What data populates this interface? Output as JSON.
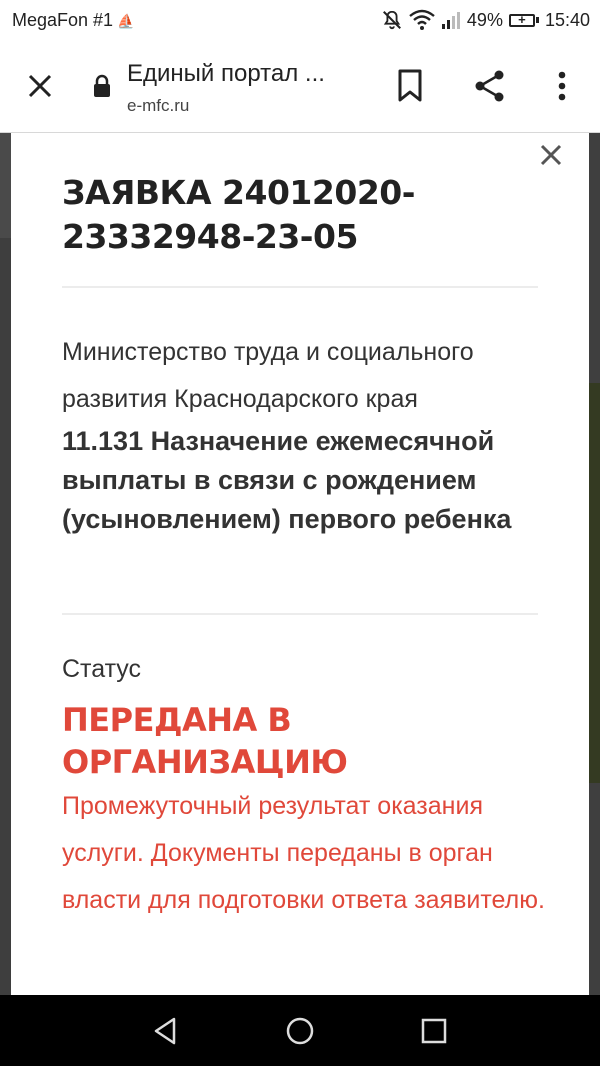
{
  "status_bar": {
    "carrier": "MegaFon #1",
    "battery_percent": "49%",
    "time": "15:40",
    "icons": [
      "boat-icon",
      "mute-icon",
      "wifi-icon",
      "signal-icon",
      "battery-charging-icon"
    ]
  },
  "browser": {
    "page_title": "Единый портал ...",
    "url": "e-mfc.ru",
    "icons": [
      "close-icon",
      "lock-icon",
      "bookmark-icon",
      "share-icon",
      "more-vert-icon"
    ]
  },
  "modal": {
    "title": "ЗАЯВКА 24012020-23332948-23-05",
    "ministry": "Министерство труда и социального развития Краснодарского края",
    "service": "11.131 Назначение ежемесячной выплаты в связи с рождением (усыновлением) первого ребенка",
    "status_label": "Статус",
    "status_value": "ПЕРЕДАНА В ОРГАНИЗАЦИЮ",
    "status_description": "Промежуточный результат оказания услуги. Документы переданы в орган власти для подготовки ответа заявителю.",
    "accent_color": "#e0483a"
  },
  "nav_bar": {
    "icons": [
      "back-icon",
      "home-icon",
      "recents-icon"
    ]
  }
}
